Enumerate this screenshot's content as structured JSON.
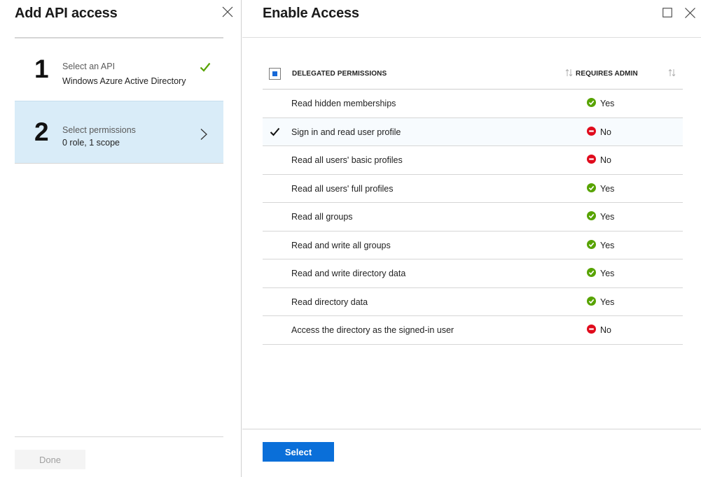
{
  "left_blade": {
    "title": "Add API access",
    "steps": [
      {
        "number": "1",
        "label": "Select an API",
        "value": "Windows Azure Active Directory",
        "icon": "checkmark-icon",
        "status_color": "#57a300"
      },
      {
        "number": "2",
        "label": "Select permissions",
        "value": "0 role, 1 scope",
        "icon": "chevron-right-icon"
      }
    ],
    "done_label": "Done"
  },
  "right_blade": {
    "title": "Enable Access",
    "columns": {
      "permission": "DELEGATED PERMISSIONS",
      "admin": "REQUIRES ADMIN"
    },
    "rows": [
      {
        "permission": "Read hidden memberships",
        "admin": "Yes",
        "checked": false
      },
      {
        "permission": "Sign in and read user profile",
        "admin": "No",
        "checked": true
      },
      {
        "permission": "Read all users' basic profiles",
        "admin": "No",
        "checked": false
      },
      {
        "permission": "Read all users' full profiles",
        "admin": "Yes",
        "checked": false
      },
      {
        "permission": "Read all groups",
        "admin": "Yes",
        "checked": false
      },
      {
        "permission": "Read and write all groups",
        "admin": "Yes",
        "checked": false
      },
      {
        "permission": "Read and write directory data",
        "admin": "Yes",
        "checked": false
      },
      {
        "permission": "Read directory data",
        "admin": "Yes",
        "checked": false
      },
      {
        "permission": "Access the directory as the signed-in user",
        "admin": "No",
        "checked": false
      }
    ],
    "select_label": "Select"
  },
  "colors": {
    "accent": "#0a6fd9",
    "selected_step_bg": "#d9ecf8",
    "yes_green": "#57a300",
    "no_red": "#e00b1c"
  }
}
